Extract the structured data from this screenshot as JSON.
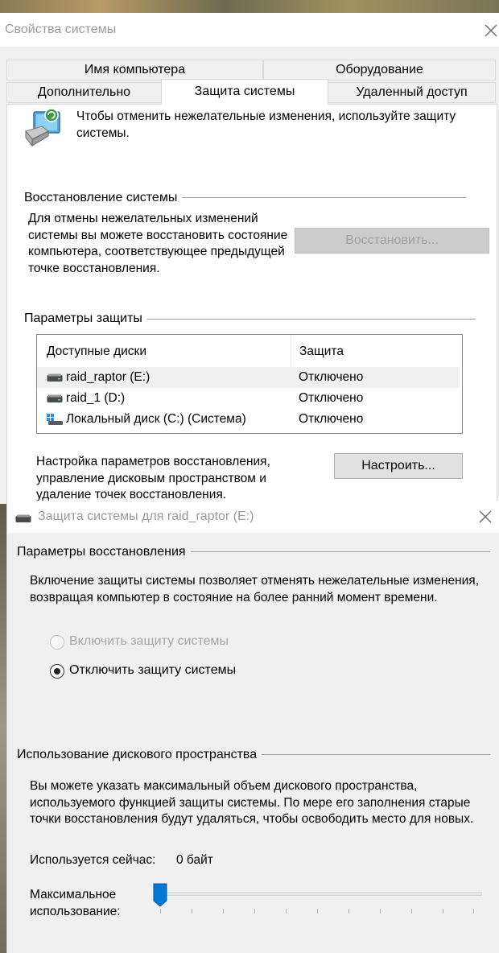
{
  "win1": {
    "title": "Свойства системы",
    "tabs": {
      "computer_name": "Имя компьютера",
      "hardware": "Оборудование",
      "advanced": "Дополнительно",
      "protection": "Защита системы",
      "remote": "Удаленный доступ"
    },
    "intro": "Чтобы отменить нежелательные изменения, используйте защиту системы.",
    "restore_group": "Восстановление системы",
    "restore_text": "Для отмены нежелательных изменений системы вы можете восстановить состояние компьютера, соответствующее предыдущей точке восстановления.",
    "restore_button": "Восстановить...",
    "params_group": "Параметры защиты",
    "disk_list": {
      "col_disks": "Доступные диски",
      "col_protection": "Защита",
      "rows": [
        {
          "name": "raid_raptor (E:)",
          "state": "Отключено",
          "icon": "drive-icon"
        },
        {
          "name": "raid_1 (D:)",
          "state": "Отключено",
          "icon": "drive-icon"
        },
        {
          "name": "Локальный диск (C:) (Система)",
          "state": "Отключено",
          "icon": "windows-drive-icon"
        }
      ]
    },
    "config_text": "Настройка параметров восстановления, управление дисковым пространством и удаление точек восстановления.",
    "config_button": "Настроить..."
  },
  "win2": {
    "title": "Защита системы для raid_raptor (E:)",
    "restore_params_group": "Параметры восстановления",
    "restore_params_text": "Включение защиты системы позволяет отменять нежелательные изменения, возвращая компьютер в состояние на более ранний момент времени.",
    "radio_enable": "Включить защиту системы",
    "radio_disable": "Отключить защиту системы",
    "disk_usage_group": "Использование дискового пространства",
    "disk_usage_text": "Вы можете указать максимальный объем дискового пространства, используемого функцией защиты системы. По мере его заполнения старые точки восстановления будут удаляться, чтобы освободить место для новых.",
    "used_now_label": "Используется сейчас:",
    "used_now_value": "0 байт",
    "max_usage_label": "Максимальное использование:",
    "max_usage_percent": 0
  },
  "colors": {
    "accent": "#0078d7",
    "window_bg": "#f0f0f0",
    "disabled_text": "#a0a0a0"
  }
}
